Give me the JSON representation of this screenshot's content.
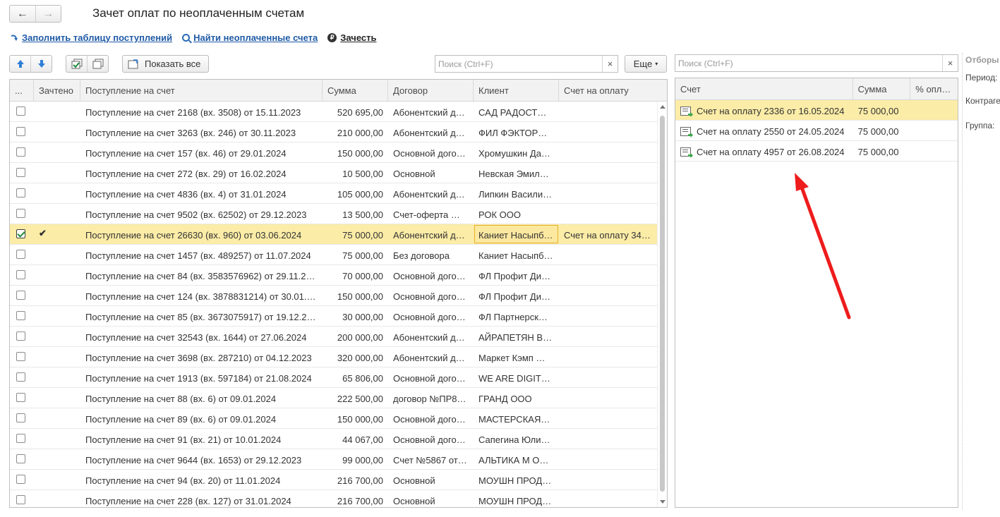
{
  "window": {
    "title": "Зачет оплат по неоплаченным счетам"
  },
  "nav": {
    "back_icon": "←",
    "forward_icon": "→"
  },
  "commands": {
    "fill": "Заполнить таблицу поступлений",
    "find": "Найти неоплаченные счета",
    "offset": "Зачесть"
  },
  "left_toolbar": {
    "show_all": "Показать все",
    "search_placeholder": "Поиск (Ctrl+F)",
    "more": "Еще"
  },
  "left_table": {
    "columns": [
      "...",
      "Зачтено",
      "Поступление на счет",
      "Сумма",
      "Договор",
      "Клиент",
      "Счет на оплату"
    ],
    "rows": [
      {
        "checked": false,
        "offset": "",
        "doc": "Поступление на счет 2168 (вх. 3508) от 15.11.2023",
        "sum": "520 695,00",
        "contract": "Абонентский д…",
        "client": "САД РАДОСТ…",
        "invoice": ""
      },
      {
        "checked": false,
        "offset": "",
        "doc": "Поступление на счет 3263 (вх. 246) от 30.11.2023",
        "sum": "210 000,00",
        "contract": "Абонентский д…",
        "client": "ФИЛ ФЭКТОР…",
        "invoice": ""
      },
      {
        "checked": false,
        "offset": "",
        "doc": "Поступление на счет 157 (вх. 46) от 29.01.2024",
        "sum": "150 000,00",
        "contract": "Основной дого…",
        "client": "Хромушкин Да…",
        "invoice": ""
      },
      {
        "checked": false,
        "offset": "",
        "doc": "Поступление на счет 272 (вх. 29) от 16.02.2024",
        "sum": "10 500,00",
        "contract": "Основной",
        "client": "Невская Эмил…",
        "invoice": ""
      },
      {
        "checked": false,
        "offset": "",
        "doc": "Поступление на счет 4836 (вх. 4) от 31.01.2024",
        "sum": "105 000,00",
        "contract": "Абонентский д…",
        "client": "Липкин Васили…",
        "invoice": ""
      },
      {
        "checked": false,
        "offset": "",
        "doc": "Поступление на счет 9502 (вх. 62502) от 29.12.2023",
        "sum": "13 500,00",
        "contract": "Счет-оферта …",
        "client": "РОК ООО",
        "invoice": ""
      },
      {
        "checked": true,
        "offset": "✔",
        "doc": "Поступление на счет 26630 (вх. 960) от 03.06.2024",
        "sum": "75 000,00",
        "contract": "Абонентский д…",
        "client": "Каниет Насыпб…",
        "invoice": "Счет на оплату 34…",
        "selected": true
      },
      {
        "checked": false,
        "offset": "",
        "doc": "Поступление на счет 1457 (вх. 489257) от 11.07.2024",
        "sum": "75 000,00",
        "contract": "Без договора",
        "client": "Каниет Насыпб…",
        "invoice": ""
      },
      {
        "checked": false,
        "offset": "",
        "doc": "Поступление на счет 84 (вх. 3583576962) от 29.11.2…",
        "sum": "70 000,00",
        "contract": "Основной дого…",
        "client": "ФЛ Профит Ди…",
        "invoice": ""
      },
      {
        "checked": false,
        "offset": "",
        "doc": "Поступление на счет 124 (вх. 3878831214) от 30.01.…",
        "sum": "150 000,00",
        "contract": "Основной дого…",
        "client": "ФЛ Профит Ди…",
        "invoice": ""
      },
      {
        "checked": false,
        "offset": "",
        "doc": "Поступление на счет 85 (вх. 3673075917) от 19.12.2…",
        "sum": "30 000,00",
        "contract": "Основной дого…",
        "client": "ФЛ Партнерск…",
        "invoice": ""
      },
      {
        "checked": false,
        "offset": "",
        "doc": "Поступление на счет 32543 (вх. 1644) от 27.06.2024",
        "sum": "200 000,00",
        "contract": "Абонентский д…",
        "client": "АЙРАПЕТЯН В…",
        "invoice": ""
      },
      {
        "checked": false,
        "offset": "",
        "doc": "Поступление на счет 3698 (вх. 287210) от 04.12.2023",
        "sum": "320 000,00",
        "contract": "Абонентский д…",
        "client": "Маркет Кэмп …",
        "invoice": ""
      },
      {
        "checked": false,
        "offset": "",
        "doc": "Поступление на счет 1913 (вх. 597184) от 21.08.2024",
        "sum": "65 806,00",
        "contract": "Основной дого…",
        "client": "WE ARE DIGIT…",
        "invoice": ""
      },
      {
        "checked": false,
        "offset": "",
        "doc": "Поступление на счет 88 (вх. 6) от 09.01.2024",
        "sum": "222 500,00",
        "contract": "договор №ПР8…",
        "client": "ГРАНД ООО",
        "invoice": ""
      },
      {
        "checked": false,
        "offset": "",
        "doc": "Поступление на счет 89 (вх. 6) от 09.01.2024",
        "sum": "150 000,00",
        "contract": "Основной дого…",
        "client": "МАСТЕРСКАЯ…",
        "invoice": ""
      },
      {
        "checked": false,
        "offset": "",
        "doc": "Поступление на счет 91 (вх. 21) от 10.01.2024",
        "sum": "44 067,00",
        "contract": "Основной дого…",
        "client": "Сапегина Юли…",
        "invoice": ""
      },
      {
        "checked": false,
        "offset": "",
        "doc": "Поступление на счет 9644 (вх. 1653) от 29.12.2023",
        "sum": "99 000,00",
        "contract": "Счет №5867 от…",
        "client": "АЛЬТИКА М О…",
        "invoice": ""
      },
      {
        "checked": false,
        "offset": "",
        "doc": "Поступление на счет 94 (вх. 20) от 11.01.2024",
        "sum": "216 700,00",
        "contract": "Основной",
        "client": "МОУШН ПРОД…",
        "invoice": ""
      },
      {
        "checked": false,
        "offset": "",
        "doc": "Поступление на счет 228 (вх. 127) от 31.01.2024",
        "sum": "216 700,00",
        "contract": "Основной",
        "client": "МОУШН ПРОД…",
        "invoice": ""
      }
    ]
  },
  "right_search": {
    "placeholder": "Поиск (Ctrl+F)"
  },
  "right_table": {
    "columns": [
      "Счет",
      "Сумма",
      "% опл…"
    ],
    "rows": [
      {
        "invoice": "Счет на оплату 2336 от 16.05.2024",
        "sum": "75 000,00",
        "pct": "",
        "selected": true
      },
      {
        "invoice": "Счет на оплату 2550 от 24.05.2024",
        "sum": "75 000,00",
        "pct": ""
      },
      {
        "invoice": "Счет на оплату 4957 от 26.08.2024",
        "sum": "75 000,00",
        "pct": ""
      }
    ]
  },
  "side_panel": {
    "title": "Отборы",
    "period": "Период:",
    "counterparty": "Контраге",
    "group": "Группа:"
  },
  "colors": {
    "selected_row": "#fbeca7",
    "link": "#1f5aa6",
    "annotation_arrow": "#ee1c1c"
  }
}
